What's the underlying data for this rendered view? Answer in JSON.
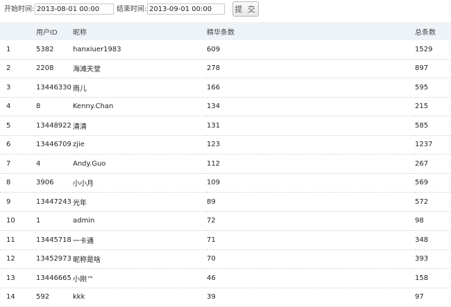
{
  "filter": {
    "start_label": "开始时间:",
    "start_value": "2013-08-01 00:00",
    "end_label": "结束时间:",
    "end_value": "2013-09-01 00:00",
    "submit_label": "提 交"
  },
  "table": {
    "headers": [
      "",
      "用户ID",
      "昵称",
      "精华条数",
      "总条数"
    ],
    "rows": [
      {
        "rank": "1",
        "uid": "5382",
        "nick": "hanxiuer1983",
        "essence": "609",
        "total": "1529"
      },
      {
        "rank": "2",
        "uid": "2208",
        "nick": "海滩天堂",
        "essence": "278",
        "total": "897"
      },
      {
        "rank": "3",
        "uid": "13446330",
        "nick": "雨儿",
        "essence": "166",
        "total": "595"
      },
      {
        "rank": "4",
        "uid": "8",
        "nick": "Kenny.Chan",
        "essence": "134",
        "total": "215"
      },
      {
        "rank": "5",
        "uid": "13448922",
        "nick": "清清",
        "essence": "131",
        "total": "585"
      },
      {
        "rank": "6",
        "uid": "13446709",
        "nick": "zjie",
        "essence": "123",
        "total": "1237"
      },
      {
        "rank": "7",
        "uid": "4",
        "nick": "Andy.Guo",
        "essence": "112",
        "total": "267"
      },
      {
        "rank": "8",
        "uid": "3906",
        "nick": "小小月",
        "essence": "109",
        "total": "569"
      },
      {
        "rank": "9",
        "uid": "13447243",
        "nick": "光年",
        "essence": "89",
        "total": "572"
      },
      {
        "rank": "10",
        "uid": "1",
        "nick": "admin",
        "essence": "72",
        "total": "98"
      },
      {
        "rank": "11",
        "uid": "13445718",
        "nick": "一卡通",
        "essence": "71",
        "total": "348"
      },
      {
        "rank": "12",
        "uid": "13452973",
        "nick": "昵称是啥",
        "essence": "70",
        "total": "393"
      },
      {
        "rank": "13",
        "uid": "13446665",
        "nick": "小刚™",
        "essence": "46",
        "total": "158"
      },
      {
        "rank": "14",
        "uid": "592",
        "nick": "kkk",
        "essence": "39",
        "total": "97"
      }
    ]
  }
}
